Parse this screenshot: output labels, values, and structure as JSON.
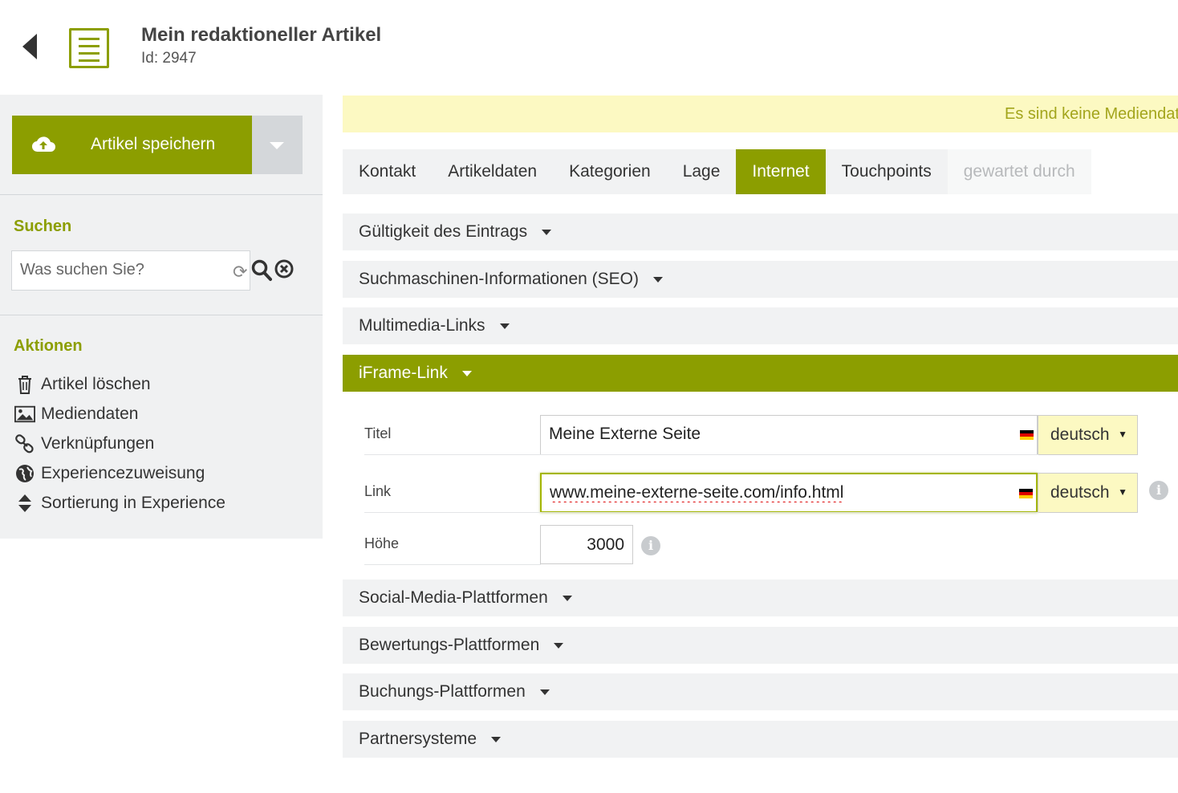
{
  "header": {
    "title": "Mein redaktioneller Artikel",
    "id_label": "Id: 2947"
  },
  "sidebar": {
    "save_label": "Artikel speichern",
    "search_title": "Suchen",
    "search_placeholder": "Was suchen Sie?",
    "actions_title": "Aktionen",
    "actions": [
      {
        "label": "Artikel löschen",
        "icon": "trash-icon"
      },
      {
        "label": "Mediendaten",
        "icon": "image-icon"
      },
      {
        "label": "Verknüpfungen",
        "icon": "link-icon"
      },
      {
        "label": "Experiencezuweisung",
        "icon": "globe-icon"
      },
      {
        "label": "Sortierung in Experience",
        "icon": "sort-icon"
      }
    ]
  },
  "notice": "Es sind keine Mediendaten vorhanden",
  "tabs": [
    {
      "label": "Kontakt",
      "state": "normal"
    },
    {
      "label": "Artikeldaten",
      "state": "normal"
    },
    {
      "label": "Kategorien",
      "state": "normal"
    },
    {
      "label": "Lage",
      "state": "normal"
    },
    {
      "label": "Internet",
      "state": "active"
    },
    {
      "label": "Touchpoints",
      "state": "normal"
    },
    {
      "label": "gewartet durch",
      "state": "disabled"
    }
  ],
  "sections": {
    "validity": "Gültigkeit des Eintrags",
    "seo": "Suchmaschinen-Informationen (SEO)",
    "multimedia": "Multimedia-Links",
    "iframe": "iFrame-Link",
    "social": "Social-Media-Plattformen",
    "ratings": "Bewertungs-Plattformen",
    "booking": "Buchungs-Plattformen",
    "partner": "Partnersysteme"
  },
  "iframe": {
    "title_label": "Titel",
    "title_value": "Meine Externe Seite",
    "title_lang": "deutsch",
    "link_label": "Link",
    "link_value": "www.meine-externe-seite.com/info.html",
    "link_lang": "deutsch",
    "height_label": "Höhe",
    "height_value": "3000"
  },
  "colors": {
    "accent": "#8c9e00",
    "notice_bg": "#fcf9c2",
    "panel_bg": "#f1f2f3"
  }
}
